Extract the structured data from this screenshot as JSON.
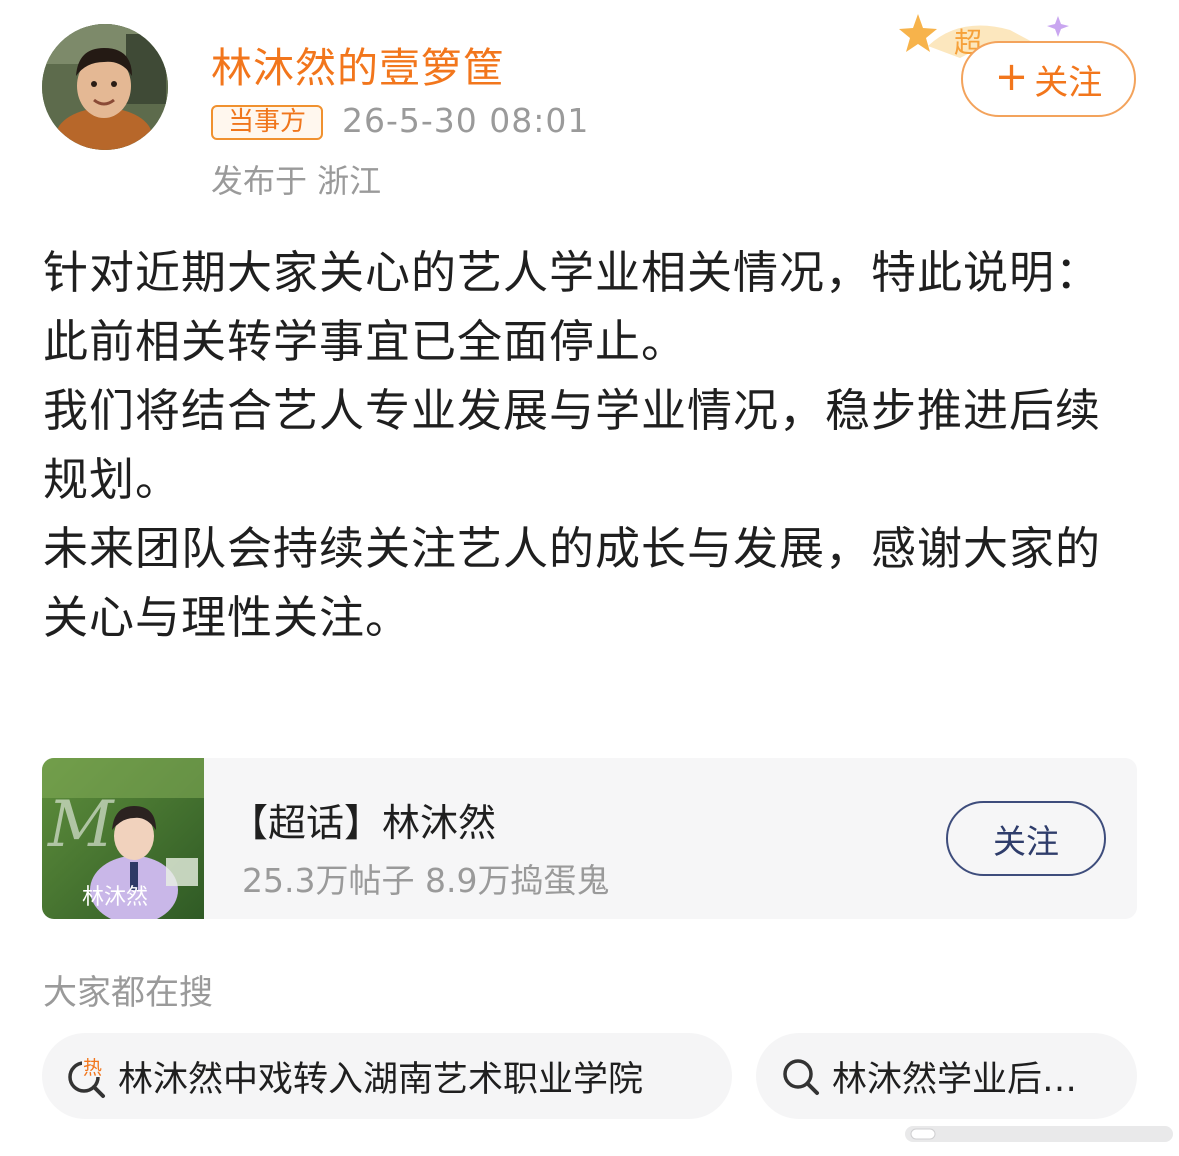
{
  "post": {
    "username": "林沐然的壹箩筐",
    "badge": "当事方",
    "timestamp": "26-5-30 08:01",
    "location": "发布于 浙江",
    "follow_label": "关注",
    "follow_plus": "+",
    "paragraphs": [
      "针对近期大家关心的艺人学业相关情况，特此说明：",
      "此前相关转学事宜已全面停止。",
      "我们将结合艺人专业发展与学业情况，稳步推进后续规划。",
      "未来团队会持续关注艺人的成长与发展，感谢大家的关心与理性关注。"
    ]
  },
  "topic_card": {
    "title": "【超话】林沐然",
    "stats": "25.3万帖子  8.9万捣蛋鬼",
    "follow_label": "关注",
    "cover_caption": "林沐然"
  },
  "search": {
    "heading": "大家都在搜",
    "chips": [
      {
        "text": "林沐然中戏转入湖南艺术职业学院",
        "icon": "hot-search-icon",
        "hot_label": "热"
      },
      {
        "text": "林沐然学业后…",
        "icon": "search-icon"
      }
    ]
  },
  "colors": {
    "accent": "#f2761c",
    "muted": "#9a9a9a",
    "topic_button": "#3e4d7c",
    "card_bg": "#f6f6f7"
  }
}
